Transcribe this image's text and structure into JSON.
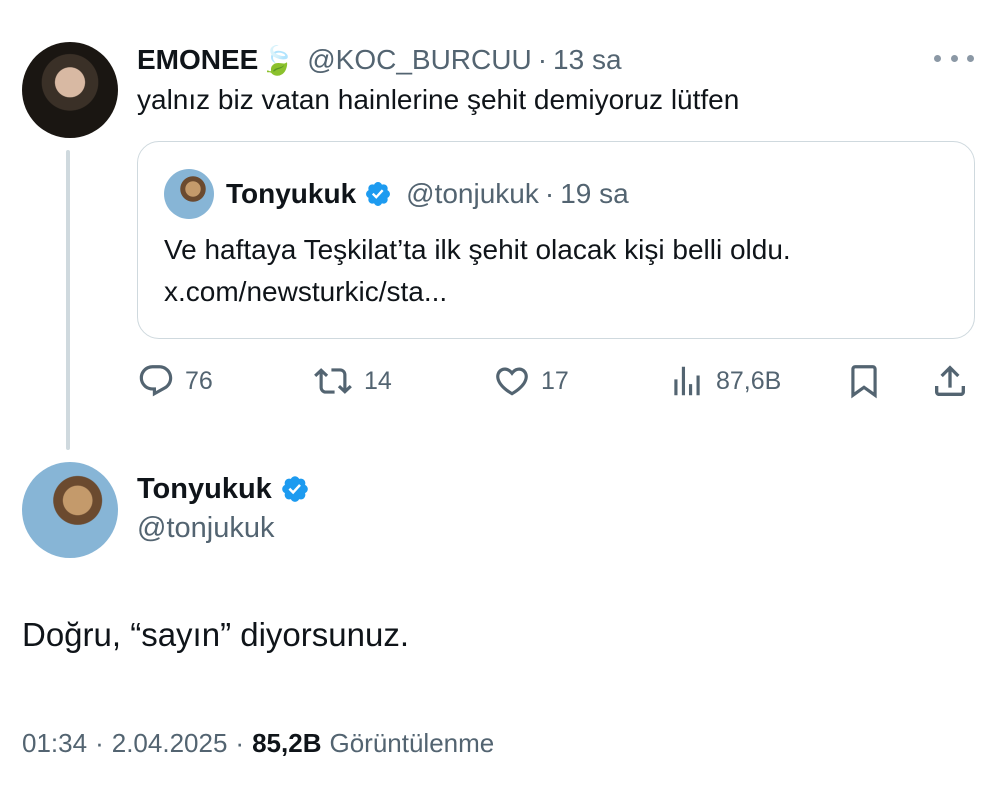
{
  "parent_tweet": {
    "display_name": "EMONEE",
    "name_emoji": "🍃",
    "handle": "@KOC_BURCUU",
    "separator": "·",
    "time": "13 sa",
    "text": "yalnız biz vatan hainlerine şehit demiyoruz lütfen",
    "quoted": {
      "display_name": "Tonyukuk",
      "handle": "@tonjukuk",
      "separator": "·",
      "time": "19 sa",
      "text_line1": "Ve haftaya Teşkilat’ta ilk şehit olacak kişi belli oldu.",
      "text_line2": "x.com/newsturkic/sta..."
    },
    "actions": {
      "replies": "76",
      "retweets": "14",
      "likes": "17",
      "views": "87,6B"
    }
  },
  "main_tweet": {
    "display_name": "Tonyukuk",
    "handle": "@tonjukuk",
    "text": "Doğru, “sayın” diyorsunuz.",
    "time": "01:34",
    "separator": "·",
    "date": "2.04.2025",
    "views_count": "85,2B",
    "views_label": "Görüntülenme"
  },
  "colors": {
    "verified_blue": "#1d9bf0",
    "muted_text": "#536471",
    "border": "#cfd9de"
  }
}
